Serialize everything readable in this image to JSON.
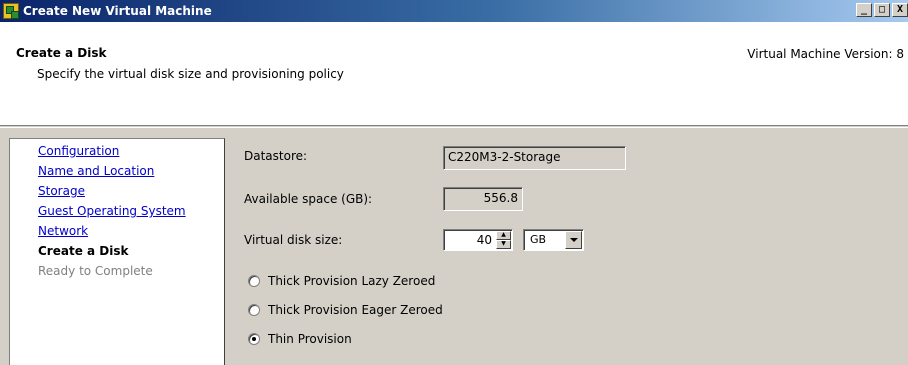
{
  "window": {
    "title": "Create New Virtual Machine",
    "controls": {
      "minimize": "_",
      "maximize": "□",
      "close": "X"
    }
  },
  "header": {
    "title": "Create a Disk",
    "subtitle": "Specify the virtual disk size and provisioning policy",
    "version": "Virtual Machine Version: 8"
  },
  "nav": {
    "items": [
      {
        "label": "Configuration",
        "state": "link"
      },
      {
        "label": "Name and Location",
        "state": "link"
      },
      {
        "label": "Storage",
        "state": "link"
      },
      {
        "label": "Guest Operating System",
        "state": "link"
      },
      {
        "label": "Network",
        "state": "link"
      },
      {
        "label": "Create a Disk",
        "state": "current"
      },
      {
        "label": "Ready to Complete",
        "state": "disabled"
      }
    ]
  },
  "form": {
    "datastore_label": "Datastore:",
    "datastore_value": "C220M3-2-Storage",
    "available_label": "Available space (GB):",
    "available_value": "556.8",
    "disk_size_label": "Virtual disk size:",
    "disk_size_value": "40",
    "disk_unit": "GB",
    "provisioning": [
      {
        "label": "Thick Provision Lazy Zeroed",
        "checked": false
      },
      {
        "label": "Thick Provision Eager Zeroed",
        "checked": false
      },
      {
        "label": "Thin Provision",
        "checked": true
      }
    ]
  }
}
